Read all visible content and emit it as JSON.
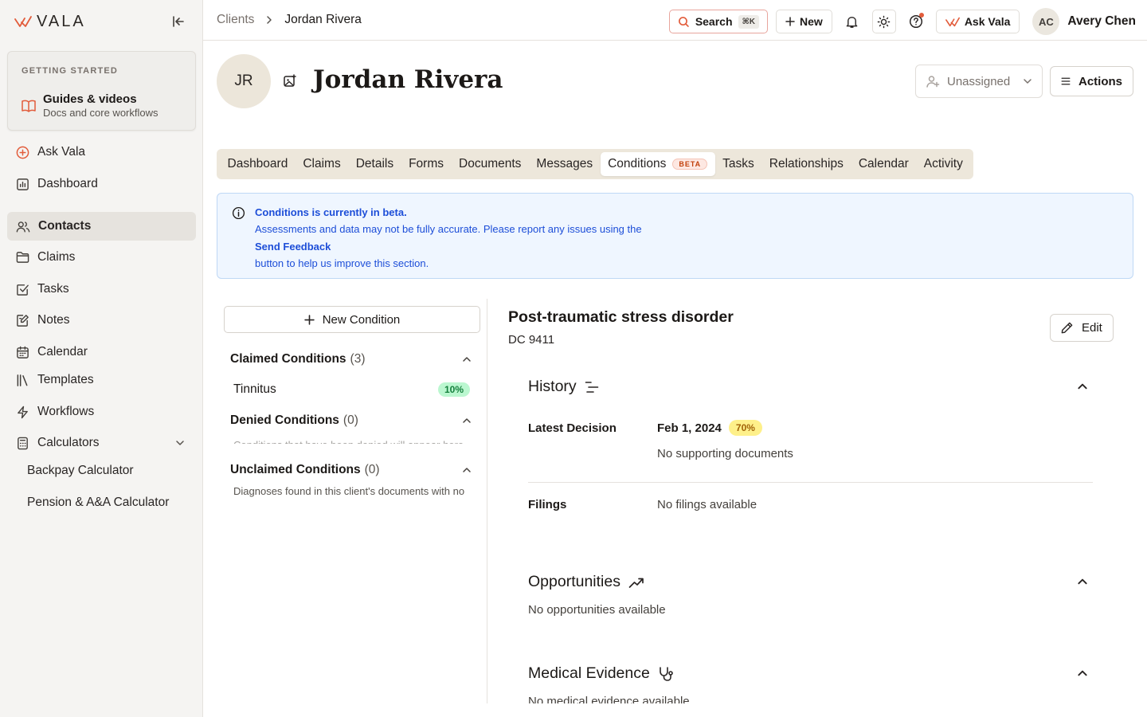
{
  "app": {
    "logo_text": "VALA"
  },
  "sidebar": {
    "getting_started": {
      "label": "GETTING STARTED",
      "title": "Guides & videos",
      "subtitle": "Docs and core workflows"
    },
    "items": [
      {
        "label": "Ask Vala"
      },
      {
        "label": "Dashboard"
      },
      {
        "label": "Contacts"
      },
      {
        "label": "Claims"
      },
      {
        "label": "Tasks"
      },
      {
        "label": "Notes"
      },
      {
        "label": "Calendar"
      },
      {
        "label": "Templates"
      },
      {
        "label": "Workflows"
      },
      {
        "label": "Calculators"
      }
    ],
    "sub_items": [
      {
        "label": "Backpay Calculator"
      },
      {
        "label": "Pension & A&A Calculator"
      }
    ]
  },
  "topbar": {
    "breadcrumb": [
      "Clients",
      "Jordan Rivera"
    ],
    "search_label": "Search",
    "search_shortcut": "⌘K",
    "new_label": "New",
    "ask_vala_label": "Ask Vala",
    "user_initials": "AC",
    "user_name": "Avery Chen"
  },
  "client": {
    "initials": "JR",
    "name": "Jordan Rivera",
    "assignee_placeholder": "Unassigned",
    "actions_label": "Actions"
  },
  "tabs": [
    {
      "label": "Dashboard"
    },
    {
      "label": "Claims"
    },
    {
      "label": "Details"
    },
    {
      "label": "Forms"
    },
    {
      "label": "Documents"
    },
    {
      "label": "Messages"
    },
    {
      "label": "Conditions",
      "badge": "BETA",
      "active": true
    },
    {
      "label": "Tasks"
    },
    {
      "label": "Relationships"
    },
    {
      "label": "Calendar"
    },
    {
      "label": "Activity"
    }
  ],
  "banner": {
    "title": "Conditions is currently in beta.",
    "line1": "Assessments and data may not be fully accurate. Please report any issues using the",
    "link": "Send Feedback",
    "line2": "button to help us improve this section."
  },
  "conditions": {
    "new_button": "New Condition",
    "groups": [
      {
        "title": "Claimed Conditions",
        "count": "(3)",
        "items": [
          {
            "name": "Tinnitus",
            "rating": "10%"
          }
        ]
      },
      {
        "title": "Denied Conditions",
        "count": "(0)",
        "note": "Conditions that have been denied will appear here"
      },
      {
        "title": "Unclaimed Conditions",
        "count": "(0)",
        "note": "Diagnoses found in this client's documents with no corresponding claim will be listed here"
      }
    ]
  },
  "detail": {
    "title": "Post-traumatic stress disorder",
    "code": "DC 9411",
    "edit_label": "Edit",
    "history": {
      "heading": "History",
      "latest_decision_label": "Latest Decision",
      "latest_decision_date": "Feb 1, 2024",
      "latest_decision_rating": "70%",
      "supporting_docs": "No supporting documents",
      "filings_label": "Filings",
      "filings_value": "No filings available"
    },
    "opportunities": {
      "heading": "Opportunities",
      "empty": "No opportunities available"
    },
    "medical_evidence": {
      "heading": "Medical Evidence",
      "empty": "No medical evidence available"
    }
  },
  "colors": {
    "accent": "#e25c3b",
    "info": "#1d4ed8",
    "tab_bg": "#ede7db"
  }
}
